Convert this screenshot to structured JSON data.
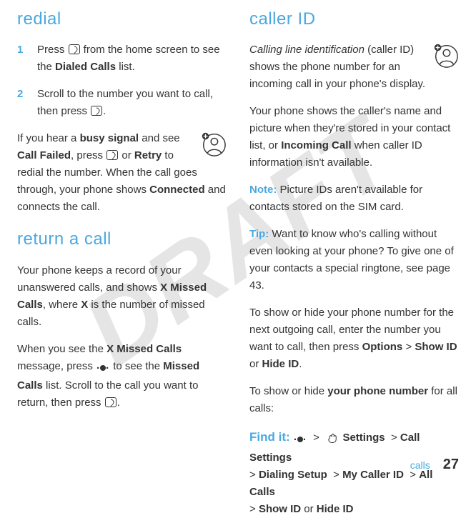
{
  "draft_watermark": "DRAFT",
  "left": {
    "heading_redial": "redial",
    "step1_num": "1",
    "step1_a": "Press ",
    "step1_b": " from the home screen to see the ",
    "step1_c": "Dialed Calls",
    "step1_d": " list.",
    "step2_num": "2",
    "step2_a": "Scroll to the number you want to call, then press ",
    "step2_b": ".",
    "busy_a": "If you hear a ",
    "busy_b": "busy signal",
    "busy_c": " and see ",
    "busy_d": "Call Failed",
    "busy_e": ", press ",
    "busy_f": " or ",
    "busy_g": "Retry",
    "busy_h": " to redial the number. When the call goes through, your phone shows ",
    "busy_i": "Connected",
    "busy_j": " and connects the call.",
    "heading_return": "return a call",
    "return_a": "Your phone keeps a record of your unanswered calls, and shows ",
    "return_b": "X Missed Calls",
    "return_c": ", where ",
    "return_d": "X",
    "return_e": " is the number of missed calls.",
    "return2_a": "When you see the ",
    "return2_b": "X Missed Calls",
    "return2_c": " message, press ",
    "return2_d": " to see the ",
    "return2_e": "Missed Calls",
    "return2_f": " list. Scroll to the call you want to return, then press ",
    "return2_g": "."
  },
  "right": {
    "heading_caller": "caller ID",
    "caller_a": "Calling line identification",
    "caller_b": " (caller ID) shows the phone number for an incoming call in your phone's display.",
    "caller2_a": "Your phone shows the caller's name and picture when they're stored in your contact list, or ",
    "caller2_b": "Incoming Call",
    "caller2_c": " when caller ID information isn't available.",
    "note_label": "Note:",
    "note_a": " Picture IDs aren't available for contacts stored on the SIM card.",
    "tip_label": "Tip:",
    "tip_a": " Want to know who's calling without even looking at your phone? To give one of your contacts a special ringtone, see page 43.",
    "show_a": "To show or hide your phone number for the next outgoing call, enter the number you want to call, then press ",
    "show_b": "Options",
    "show_c": "Show ID",
    "show_d": " or ",
    "show_e": "Hide ID",
    "show_f": ".",
    "show2_a": "To show or hide ",
    "show2_b": "your phone number",
    "show2_c": " for all calls:",
    "findit_label": "Find it:",
    "path_settings": "Settings",
    "path_callsettings": "Call Settings",
    "path_dialing": "Dialing Setup",
    "path_mycaller": "My Caller ID",
    "path_allcalls": "All Calls",
    "path_showid": "Show ID",
    "path_or": " or ",
    "path_hideid": "Hide ID",
    "gt": ">"
  },
  "footer": {
    "section": "calls",
    "page": "27"
  }
}
